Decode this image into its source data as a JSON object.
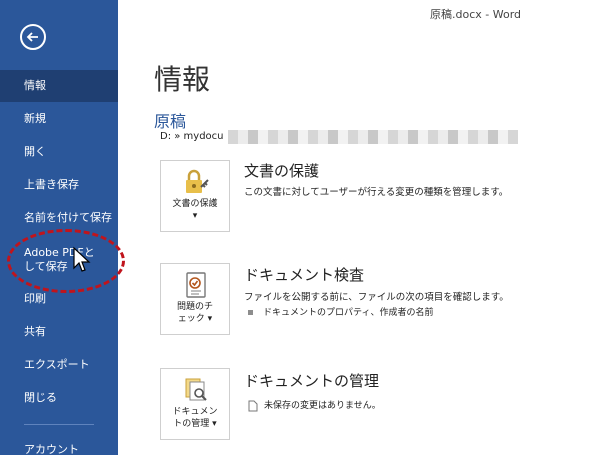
{
  "titlebar": {
    "text": "原稿.docx  -  Word"
  },
  "sidebar": {
    "items": [
      {
        "label": "情報",
        "active": true
      },
      {
        "label": "新規"
      },
      {
        "label": "開く"
      },
      {
        "label": "上書き保存"
      },
      {
        "label": "名前を付けて保存"
      },
      {
        "label": "Adobe PDFとして保存"
      },
      {
        "label": "印刷"
      },
      {
        "label": "共有"
      },
      {
        "label": "エクスポート"
      },
      {
        "label": "閉じる"
      },
      {
        "label": "アカウント"
      }
    ]
  },
  "main": {
    "title": "情報",
    "doc_name": "原稿",
    "doc_path": "D: » mydocu",
    "sections": [
      {
        "button_label": "文書の保護 ▾",
        "title": "文書の保護",
        "description": "この文書に対してユーザーが行える変更の種類を管理します。"
      },
      {
        "button_label": "問題のチェック ▾",
        "title": "ドキュメント検査",
        "description": "ファイルを公開する前に、ファイルの次の項目を確認します。",
        "bullet": "ドキュメントのプロパティ、作成者の名前"
      },
      {
        "button_label": "ドキュメントの管理 ▾",
        "title": "ドキュメントの管理",
        "bullet": "未保存の変更はありません。"
      }
    ]
  },
  "colors": {
    "sidebar": "#2b579a",
    "active_item": "#1f3f72",
    "accent": "#2b579a",
    "highlight": "#c0141c"
  }
}
